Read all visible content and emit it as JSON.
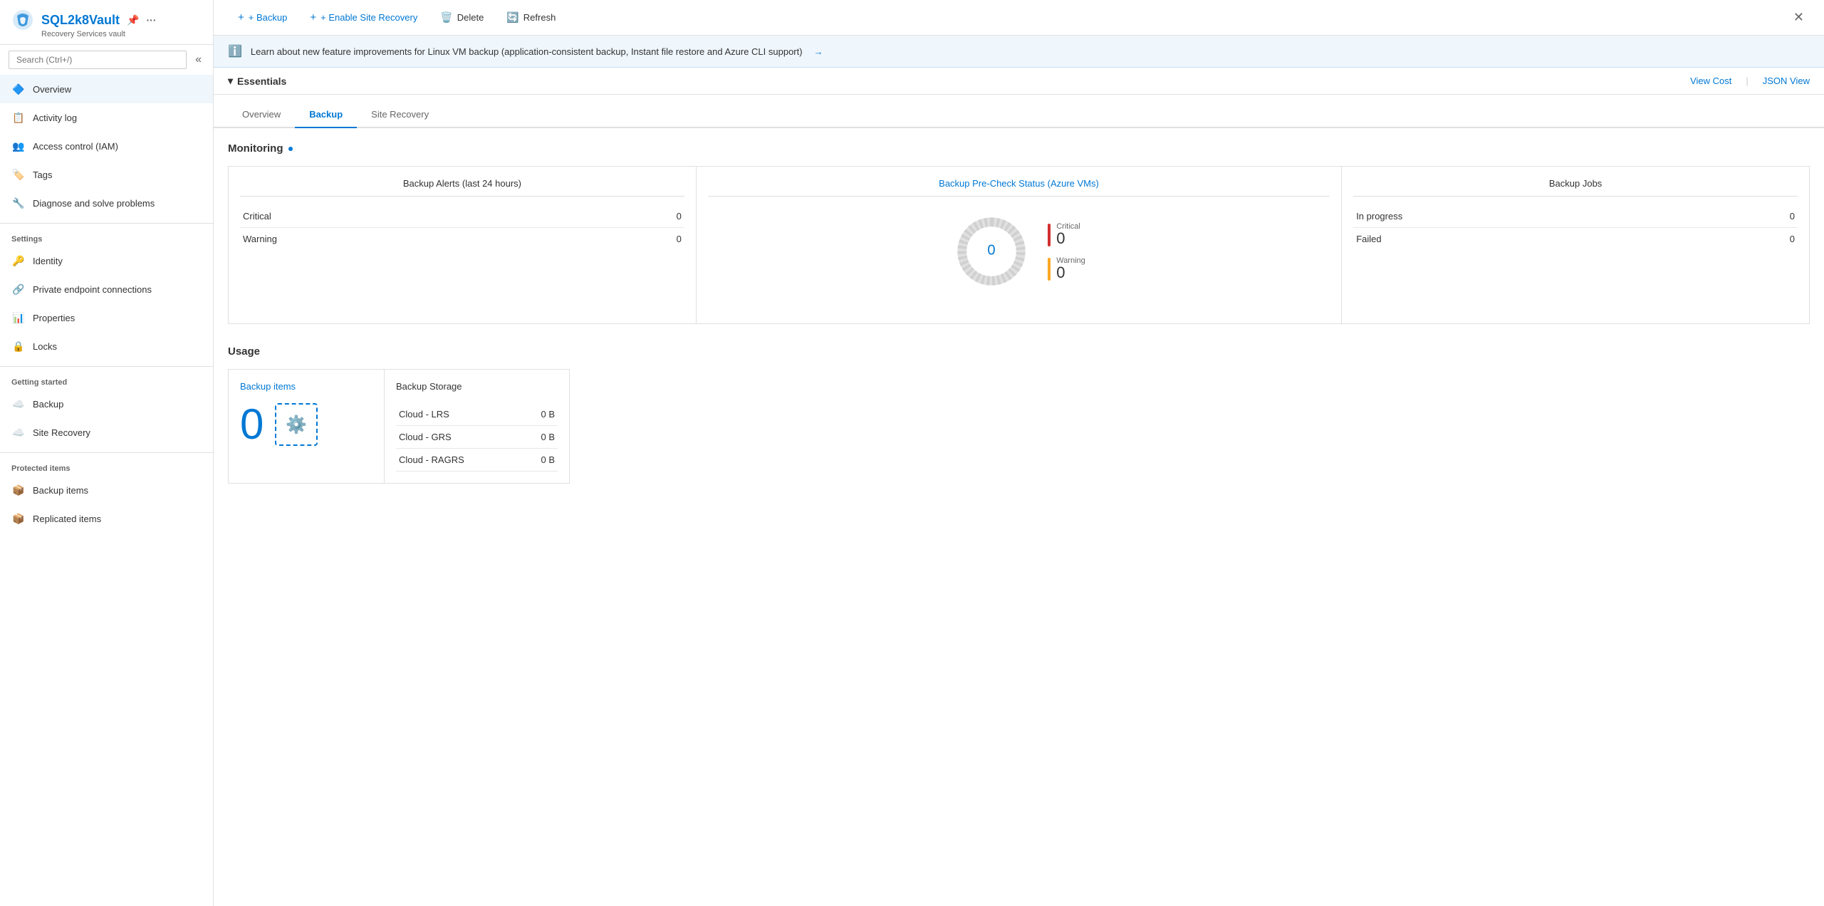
{
  "app": {
    "title": "SQL2k8Vault",
    "subtitle": "Recovery Services vault",
    "close_label": "✕"
  },
  "sidebar": {
    "search_placeholder": "Search (Ctrl+/)",
    "collapse_icon": "«",
    "nav_items": [
      {
        "id": "overview",
        "label": "Overview",
        "icon": "🔷",
        "active": true,
        "section": null
      },
      {
        "id": "activity-log",
        "label": "Activity log",
        "icon": "📋",
        "active": false,
        "section": null
      },
      {
        "id": "access-control",
        "label": "Access control (IAM)",
        "icon": "👥",
        "active": false,
        "section": null
      },
      {
        "id": "tags",
        "label": "Tags",
        "icon": "🏷️",
        "active": false,
        "section": null
      },
      {
        "id": "diagnose",
        "label": "Diagnose and solve problems",
        "icon": "🔧",
        "active": false,
        "section": null
      }
    ],
    "sections": [
      {
        "label": "Settings",
        "items": [
          {
            "id": "identity",
            "label": "Identity",
            "icon": "🔑",
            "active": false
          },
          {
            "id": "private-endpoint",
            "label": "Private endpoint connections",
            "icon": "🔗",
            "active": false
          },
          {
            "id": "properties",
            "label": "Properties",
            "icon": "📊",
            "active": false
          },
          {
            "id": "locks",
            "label": "Locks",
            "icon": "🔒",
            "active": false
          }
        ]
      },
      {
        "label": "Getting started",
        "items": [
          {
            "id": "backup-start",
            "label": "Backup",
            "icon": "☁️",
            "active": false
          },
          {
            "id": "site-recovery",
            "label": "Site Recovery",
            "icon": "☁️",
            "active": false
          }
        ]
      },
      {
        "label": "Protected items",
        "items": [
          {
            "id": "backup-items",
            "label": "Backup items",
            "icon": "📦",
            "active": false
          },
          {
            "id": "replicated-items",
            "label": "Replicated items",
            "icon": "📦",
            "active": false
          }
        ]
      }
    ]
  },
  "toolbar": {
    "backup_label": "+ Backup",
    "enable_site_recovery_label": "+ Enable Site Recovery",
    "delete_label": "Delete",
    "refresh_label": "Refresh"
  },
  "info_banner": {
    "text": "Learn about new feature improvements for Linux VM backup (application-consistent backup, Instant file restore and Azure CLI support)",
    "arrow": "→"
  },
  "essentials": {
    "label": "Essentials",
    "view_cost_label": "View Cost",
    "json_view_label": "JSON View"
  },
  "tabs": [
    {
      "id": "overview-tab",
      "label": "Overview",
      "active": false
    },
    {
      "id": "backup-tab",
      "label": "Backup",
      "active": true
    },
    {
      "id": "site-recovery-tab",
      "label": "Site Recovery",
      "active": false
    }
  ],
  "monitoring": {
    "title": "Monitoring",
    "backup_alerts": {
      "title": "Backup Alerts (last 24 hours)",
      "rows": [
        {
          "label": "Critical",
          "value": "0"
        },
        {
          "label": "Warning",
          "value": "0"
        }
      ]
    },
    "pre_check": {
      "title": "Backup Pre-Check Status (Azure VMs)",
      "center_value": "0",
      "legend": [
        {
          "label": "Critical",
          "value": "0",
          "color": "#d32f2f"
        },
        {
          "label": "Warning",
          "value": "0",
          "color": "#f9a825"
        }
      ]
    },
    "backup_jobs": {
      "title": "Backup Jobs",
      "rows": [
        {
          "label": "In progress",
          "value": "0"
        },
        {
          "label": "Failed",
          "value": "0"
        }
      ]
    }
  },
  "usage": {
    "title": "Usage",
    "backup_items": {
      "title": "Backup items",
      "value": "0",
      "icon": "⚙️"
    },
    "backup_storage": {
      "title": "Backup Storage",
      "rows": [
        {
          "label": "Cloud - LRS",
          "value": "0 B"
        },
        {
          "label": "Cloud - GRS",
          "value": "0 B"
        },
        {
          "label": "Cloud - RAGRS",
          "value": "0 B"
        }
      ]
    }
  },
  "colors": {
    "brand_blue": "#0078d4",
    "critical_red": "#d32f2f",
    "warning_yellow": "#f9a825",
    "border": "#e0e0e0"
  }
}
